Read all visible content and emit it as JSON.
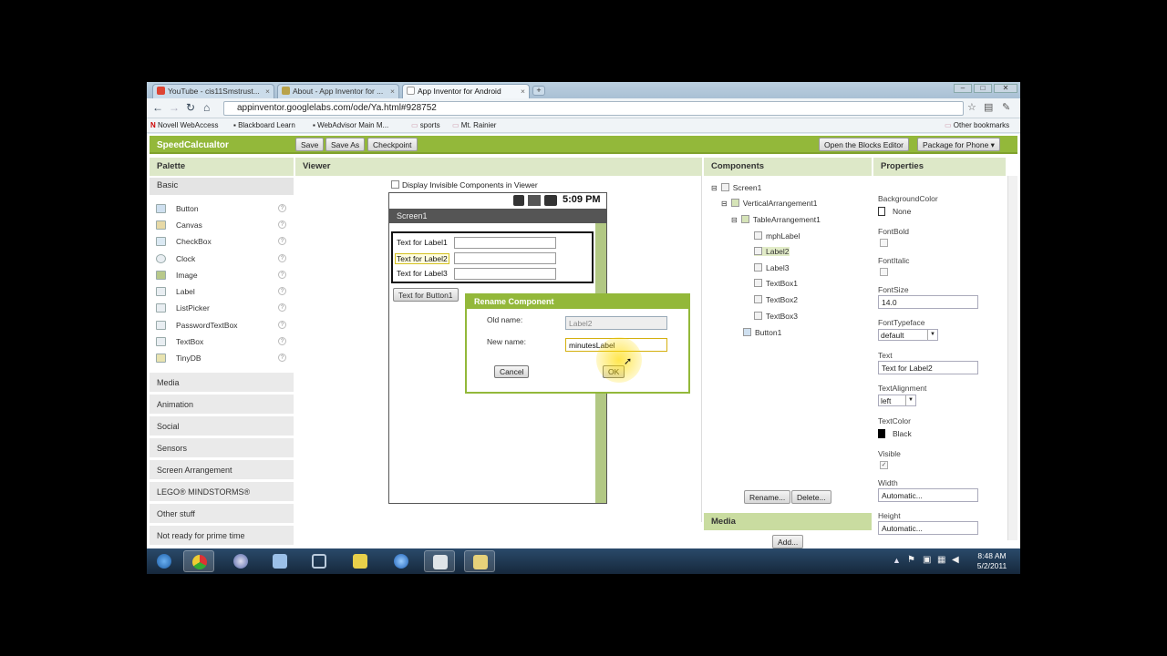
{
  "browser": {
    "tabs": [
      {
        "label": "YouTube - cis11Smstrust...",
        "color": "#d43"
      },
      {
        "label": "About - App Inventor for ...",
        "color": "#b9a24a"
      },
      {
        "label": "App Inventor for Android",
        "color": "#ffffff"
      }
    ],
    "url": "appinventor.googlelabs.com/ode/Ya.html#928752",
    "bookmarks": [
      "Novell WebAccess",
      "Blackboard Learn",
      "WebAdvisor Main M...",
      "sports",
      "Mt. Rainier"
    ],
    "other_bookmarks": "Other bookmarks"
  },
  "app": {
    "title": "SpeedCalcualtor",
    "toolbar": {
      "save": "Save",
      "save_as": "Save As",
      "checkpoint": "Checkpoint",
      "blocks_editor": "Open the Blocks Editor",
      "package": "Package for Phone ▾"
    },
    "palette": {
      "header": "Palette",
      "basic": "Basic",
      "items": [
        "Button",
        "Canvas",
        "CheckBox",
        "Clock",
        "Image",
        "Label",
        "ListPicker",
        "PasswordTextBox",
        "TextBox",
        "TinyDB"
      ],
      "categories": [
        "Media",
        "Animation",
        "Social",
        "Sensors",
        "Screen Arrangement",
        "LEGO® MINDSTORMS®",
        "Other stuff",
        "Not ready for prime time"
      ]
    },
    "viewer": {
      "header": "Viewer",
      "display_invisible": "Display Invisible Components in Viewer",
      "time": "5:09 PM",
      "screen_title": "Screen1",
      "labels": [
        "Text for Label1",
        "Text for Label2",
        "Text for Label3"
      ],
      "button": "Text for Button1"
    },
    "dialog": {
      "title": "Rename Component",
      "old_name_label": "Old name:",
      "old_name_value": "Label2",
      "new_name_label": "New name:",
      "new_name_value": "minutesLabel",
      "cancel": "Cancel",
      "ok": "OK"
    },
    "components": {
      "header": "Components",
      "tree": [
        "Screen1",
        "VerticalArrangement1",
        "TableArrangement1",
        "mphLabel",
        "Label2",
        "Label3",
        "TextBox1",
        "TextBox2",
        "TextBox3",
        "Button1"
      ],
      "rename": "Rename...",
      "delete": "Delete...",
      "media_header": "Media",
      "add": "Add..."
    },
    "properties": {
      "header": "Properties",
      "background_color_label": "BackgroundColor",
      "background_color_value": "None",
      "font_bold_label": "FontBold",
      "font_italic_label": "FontItalic",
      "font_size_label": "FontSize",
      "font_size_value": "14.0",
      "font_typeface_label": "FontTypeface",
      "font_typeface_value": "default",
      "text_label": "Text",
      "text_value": "Text for Label2",
      "text_alignment_label": "TextAlignment",
      "text_alignment_value": "left",
      "text_color_label": "TextColor",
      "text_color_value": "Black",
      "visible_label": "Visible",
      "width_label": "Width",
      "width_value": "Automatic...",
      "height_label": "Height",
      "height_value": "Automatic..."
    }
  },
  "taskbar": {
    "time": "8:48 AM",
    "date": "5/2/2011"
  }
}
